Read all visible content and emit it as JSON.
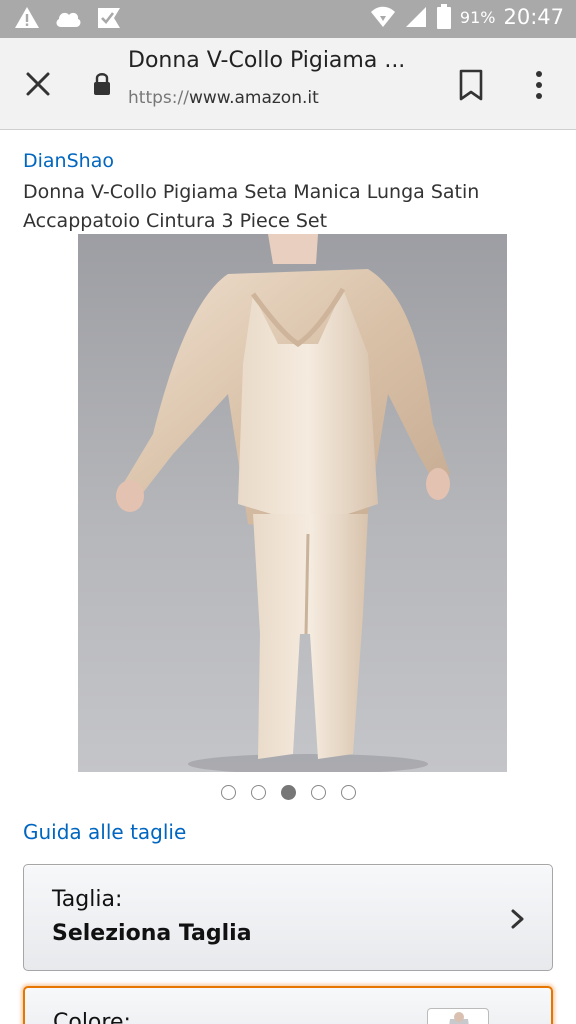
{
  "status_bar": {
    "battery_percent": "91%",
    "time": "20:47",
    "icons": [
      "warning-icon",
      "cloud-icon",
      "check-badge-icon",
      "wifi-icon",
      "signal-icon",
      "battery-icon"
    ]
  },
  "toolbar": {
    "title": "Donna V-Collo Pigiama ...",
    "url_scheme": "https://",
    "url_host": "www.amazon.it",
    "icons": [
      "close-icon",
      "lock-icon",
      "bookmark-icon",
      "more-vert-icon"
    ]
  },
  "product": {
    "brand": "DianShao",
    "title": "Donna V-Collo Pigiama Seta Manica Lunga Satin Accappatoio Cintura 3 Piece Set",
    "image_count": 5,
    "active_image_index": 2
  },
  "size_guide_link": "Guida alle taglie",
  "size_selector": {
    "label": "Taglia:",
    "value": "Seleziona Taglia"
  },
  "color_selector": {
    "label": "Colore:"
  },
  "colors": {
    "link": "#0066c0",
    "status_bar_bg": "#a9a9a9",
    "toolbar_bg": "#f2f2f2",
    "focus_border": "#e77600"
  }
}
